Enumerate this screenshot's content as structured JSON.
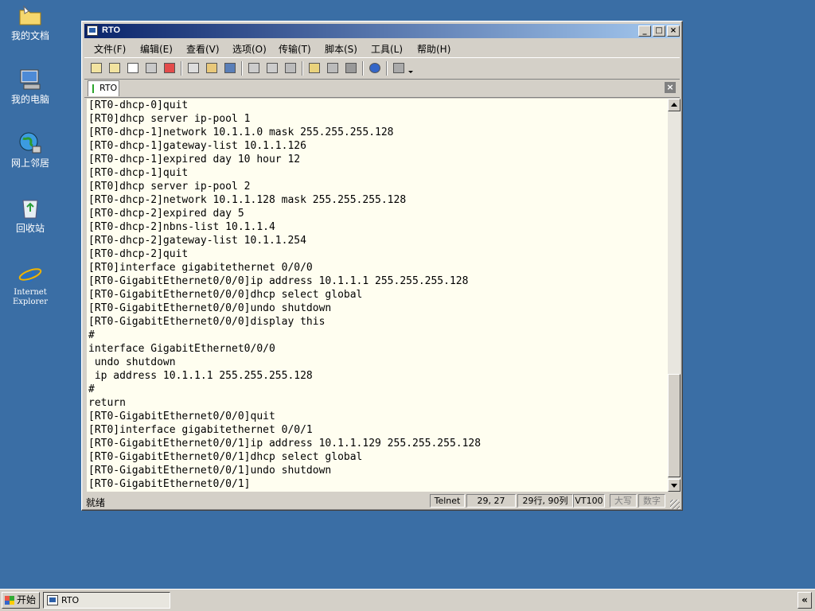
{
  "desktop": {
    "icons": [
      {
        "label": "我的文档"
      },
      {
        "label": "我的电脑"
      },
      {
        "label": "网上邻居"
      },
      {
        "label": "回收站"
      },
      {
        "label": "Internet Explorer"
      }
    ]
  },
  "window": {
    "title": "RTO",
    "controls": {
      "minimize": "_",
      "maximize": "□",
      "close": "×"
    },
    "menu": [
      "文件(F)",
      "编辑(E)",
      "查看(V)",
      "选项(O)",
      "传输(T)",
      "脚本(S)",
      "工具(L)",
      "帮助(H)"
    ],
    "tab": {
      "label": "RTO",
      "close": "×"
    },
    "terminal_lines": [
      "[RT0-dhcp-0]quit",
      "[RT0]dhcp server ip-pool 1",
      "[RT0-dhcp-1]network 10.1.1.0 mask 255.255.255.128",
      "[RT0-dhcp-1]gateway-list 10.1.1.126",
      "[RT0-dhcp-1]expired day 10 hour 12",
      "[RT0-dhcp-1]quit",
      "[RT0]dhcp server ip-pool 2",
      "[RT0-dhcp-2]network 10.1.1.128 mask 255.255.255.128",
      "[RT0-dhcp-2]expired day 5",
      "[RT0-dhcp-2]nbns-list 10.1.1.4",
      "[RT0-dhcp-2]gateway-list 10.1.1.254",
      "[RT0-dhcp-2]quit",
      "[RT0]interface gigabitethernet 0/0/0",
      "[RT0-GigabitEthernet0/0/0]ip address 10.1.1.1 255.255.255.128",
      "[RT0-GigabitEthernet0/0/0]dhcp select global",
      "[RT0-GigabitEthernet0/0/0]undo shutdown",
      "[RT0-GigabitEthernet0/0/0]display this",
      "#",
      "interface GigabitEthernet0/0/0",
      " undo shutdown",
      " ip address 10.1.1.1 255.255.255.128",
      "#",
      "return",
      "[RT0-GigabitEthernet0/0/0]quit",
      "[RT0]interface gigabitethernet 0/0/1",
      "[RT0-GigabitEthernet0/0/1]ip address 10.1.1.129 255.255.255.128",
      "[RT0-GigabitEthernet0/0/1]dhcp select global",
      "[RT0-GigabitEthernet0/0/1]undo shutdown",
      "[RT0-GigabitEthernet0/0/1]"
    ],
    "status": {
      "ready": "就绪",
      "protocol": "Telnet",
      "cursor": "29,  27",
      "size": "29行, 90列",
      "emulation": "VT100",
      "caps": "大写",
      "num": "数字"
    }
  },
  "taskbar": {
    "start": "开始",
    "task": "RTO",
    "tray": "«"
  },
  "colors": {
    "desktop": "#3a6ea5",
    "title_gradient_start": "#0a246a",
    "title_gradient_end": "#a6caf0",
    "terminal_bg": "#fffef0"
  }
}
